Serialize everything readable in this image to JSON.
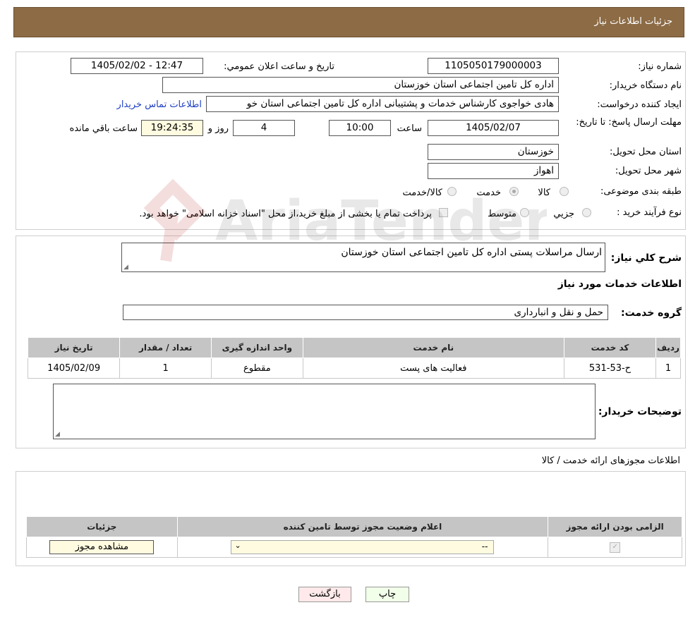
{
  "header": {
    "title": "جزئیات اطلاعات نیاز"
  },
  "form": {
    "need_number_label": "شماره نیاز:",
    "need_number": "1105050179000003",
    "announce_label": "تاریخ و ساعت اعلان عمومي:",
    "announce_value": "1405/02/02 - 12:47",
    "buyer_org_label": "نام دستگاه خريدار:",
    "buyer_org": "اداره کل تامین اجتماعی استان خوزستان",
    "creator_label": "ايجاد کننده درخواست:",
    "creator": "هادی خواجوی کارشناس خدمات و پشتیبانی اداره کل تامین اجتماعی استان خو",
    "contact_link": "اطلاعات تماس خريدار",
    "deadline_label": "مهلت ارسال پاسخ: تا تاریخ:",
    "deadline_date": "1405/02/07",
    "time_label": "ساعت",
    "deadline_time": "10:00",
    "days_value": "4",
    "days_label": "روز و",
    "remaining_time": "19:24:35",
    "remaining_label": "ساعت باقي مانده",
    "province_label": "استان محل تحویل:",
    "province": "خوزستان",
    "city_label": "شهر محل تحویل:",
    "city": "اهواز",
    "category_label": "طبقه بندی موضوعی:",
    "category_options": [
      "کالا",
      "خدمت",
      "کالا/خدمت"
    ],
    "category_selected": "خدمت",
    "process_label": "نوع فرآیند خرید :",
    "process_options": [
      "جزيي",
      "متوسط"
    ],
    "payment_note": "پرداخت تمام یا بخشی از مبلغ خرید،از محل \"اسناد خزانه اسلامی\" خواهد بود."
  },
  "details": {
    "general_desc_label": "شرح کلي نياز:",
    "general_desc": "ارسال مراسلات پستی اداره کل تامین اجتماعی استان خوزستان",
    "services_title": "اطلاعات خدمات مورد نياز",
    "service_group_label": "گروه خدمت:",
    "service_group": "حمل و نقل و انبارداری",
    "table_headers": [
      "رديف",
      "کد خدمت",
      "نام خدمت",
      "واحد اندازه گيری",
      "تعداد / مقدار",
      "تاريخ نياز"
    ],
    "rows": [
      [
        "1",
        "ح-53-531",
        "فعالیت های پست",
        "مقطوع",
        "1",
        "1405/02/09"
      ]
    ],
    "buyer_notes_label": "توضيحات خريدار:",
    "buyer_notes": ""
  },
  "permits": {
    "title": "اطلاعات مجوزهای ارائه خدمت / کالا",
    "headers": [
      "الزامی بودن ارائه مجوز",
      "اعلام وضعیت مجوز توسط تامین کننده",
      "جزئيات"
    ],
    "select_value": "--",
    "view_button": "مشاهده مجوز"
  },
  "actions": {
    "print": "چاپ",
    "back": "بازگشت"
  },
  "watermark": "AriaTender.neT",
  "colors": {
    "header_bg": "#8c6b45",
    "table_header_bg": "#c5c5c5",
    "link": "#1f3fc4"
  }
}
